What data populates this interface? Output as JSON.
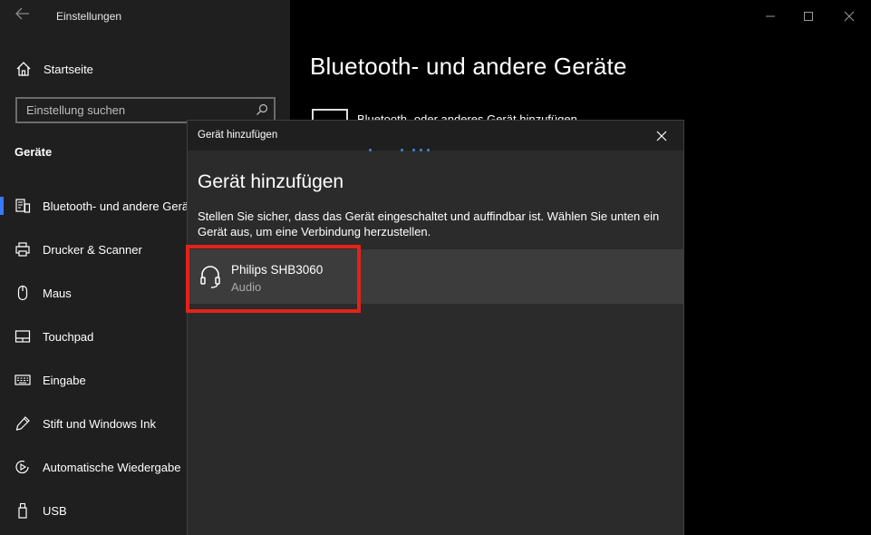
{
  "window": {
    "title": "Einstellungen",
    "back_icon": "back-arrow-icon",
    "controls": [
      "minimize-icon",
      "maximize-icon",
      "close-icon"
    ]
  },
  "sidebar": {
    "home_label": "Startseite",
    "search_placeholder": "Einstellung suchen",
    "section": "Geräte",
    "items": [
      {
        "label": "Bluetooth- und andere Geräte",
        "icon": "bluetooth-devices-icon",
        "active": true
      },
      {
        "label": "Drucker & Scanner",
        "icon": "printer-icon",
        "active": false
      },
      {
        "label": "Maus",
        "icon": "mouse-icon",
        "active": false
      },
      {
        "label": "Touchpad",
        "icon": "touchpad-icon",
        "active": false
      },
      {
        "label": "Eingabe",
        "icon": "keyboard-icon",
        "active": false
      },
      {
        "label": "Stift und Windows Ink",
        "icon": "pen-icon",
        "active": false
      },
      {
        "label": "Automatische Wiedergabe",
        "icon": "autoplay-icon",
        "active": false
      },
      {
        "label": "USB",
        "icon": "usb-icon",
        "active": false
      }
    ]
  },
  "main": {
    "title": "Bluetooth- und andere Geräte",
    "add_device_label": "Bluetooth- oder anderes Gerät hinzufügen"
  },
  "dialog": {
    "caption": "Gerät hinzufügen",
    "heading": "Gerät hinzufügen",
    "description": "Stellen Sie sicher, dass das Gerät eingeschaltet und auffindbar ist. Wählen Sie unten ein Gerät aus, um eine Verbindung herzustellen.",
    "devices": [
      {
        "name": "Philips SHB3060",
        "type": "Audio",
        "icon": "headset-icon"
      }
    ]
  },
  "colors": {
    "accent": "#3a78ff",
    "progress_dots": "#3a8dde",
    "highlight": "#e2231a"
  }
}
